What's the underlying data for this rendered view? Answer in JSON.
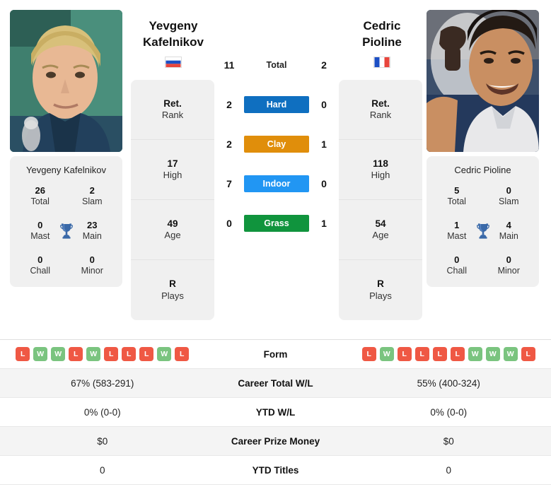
{
  "players": {
    "left": {
      "first_name": "Yevgeny",
      "last_name": "Kafelnikov",
      "full_name": "Yevgeny Kafelnikov",
      "country": "Russia",
      "flag_icon": "flag-russia-icon",
      "photo_alt": "portrait-photo-kafelnikov",
      "titles": {
        "total_value": "26",
        "total_label": "Total",
        "slam_value": "2",
        "slam_label": "Slam",
        "mast_value": "0",
        "mast_label": "Mast",
        "main_value": "23",
        "main_label": "Main",
        "chall_value": "0",
        "chall_label": "Chall",
        "minor_value": "0",
        "minor_label": "Minor"
      },
      "stats": [
        {
          "value": "Ret.",
          "label": "Rank"
        },
        {
          "value": "17",
          "label": "High"
        },
        {
          "value": "49",
          "label": "Age"
        },
        {
          "value": "R",
          "label": "Plays"
        }
      ],
      "form": [
        "L",
        "W",
        "W",
        "L",
        "W",
        "L",
        "L",
        "L",
        "W",
        "L"
      ],
      "career_total_wl": "67% (583-291)",
      "ytd_wl": "0% (0-0)",
      "career_prize_money": "$0",
      "ytd_titles": "0"
    },
    "right": {
      "first_name": "Cedric",
      "last_name": "Pioline",
      "full_name": "Cedric Pioline",
      "country": "France",
      "flag_icon": "flag-france-icon",
      "photo_alt": "portrait-photo-pioline",
      "titles": {
        "total_value": "5",
        "total_label": "Total",
        "slam_value": "0",
        "slam_label": "Slam",
        "mast_value": "1",
        "mast_label": "Mast",
        "main_value": "4",
        "main_label": "Main",
        "chall_value": "0",
        "chall_label": "Chall",
        "minor_value": "0",
        "minor_label": "Minor"
      },
      "stats": [
        {
          "value": "Ret.",
          "label": "Rank"
        },
        {
          "value": "118",
          "label": "High"
        },
        {
          "value": "54",
          "label": "Age"
        },
        {
          "value": "R",
          "label": "Plays"
        }
      ],
      "form": [
        "L",
        "W",
        "L",
        "L",
        "L",
        "L",
        "W",
        "W",
        "W",
        "L"
      ],
      "career_total_wl": "55% (400-324)",
      "ytd_wl": "0% (0-0)",
      "career_prize_money": "$0",
      "ytd_titles": "0"
    }
  },
  "head_to_head": {
    "total": {
      "label": "Total",
      "left": "11",
      "right": "2"
    },
    "surfaces": [
      {
        "label": "Hard",
        "left": "2",
        "right": "0",
        "color": "#0f6fc0"
      },
      {
        "label": "Clay",
        "left": "2",
        "right": "1",
        "color": "#e08e0b"
      },
      {
        "label": "Indoor",
        "left": "7",
        "right": "0",
        "color": "#2196f3"
      },
      {
        "label": "Grass",
        "left": "0",
        "right": "1",
        "color": "#10943d"
      }
    ]
  },
  "comparison_table": {
    "rows": [
      {
        "label": "Form"
      },
      {
        "label": "Career Total W/L"
      },
      {
        "label": "YTD W/L"
      },
      {
        "label": "Career Prize Money"
      },
      {
        "label": "YTD Titles"
      }
    ]
  },
  "colors": {
    "win_badge": "#7ac47f",
    "loss_badge": "#ef5844",
    "card_background": "#f0f0f0",
    "trophy": "#3a69a8",
    "row_alt": "#f4f4f4"
  }
}
